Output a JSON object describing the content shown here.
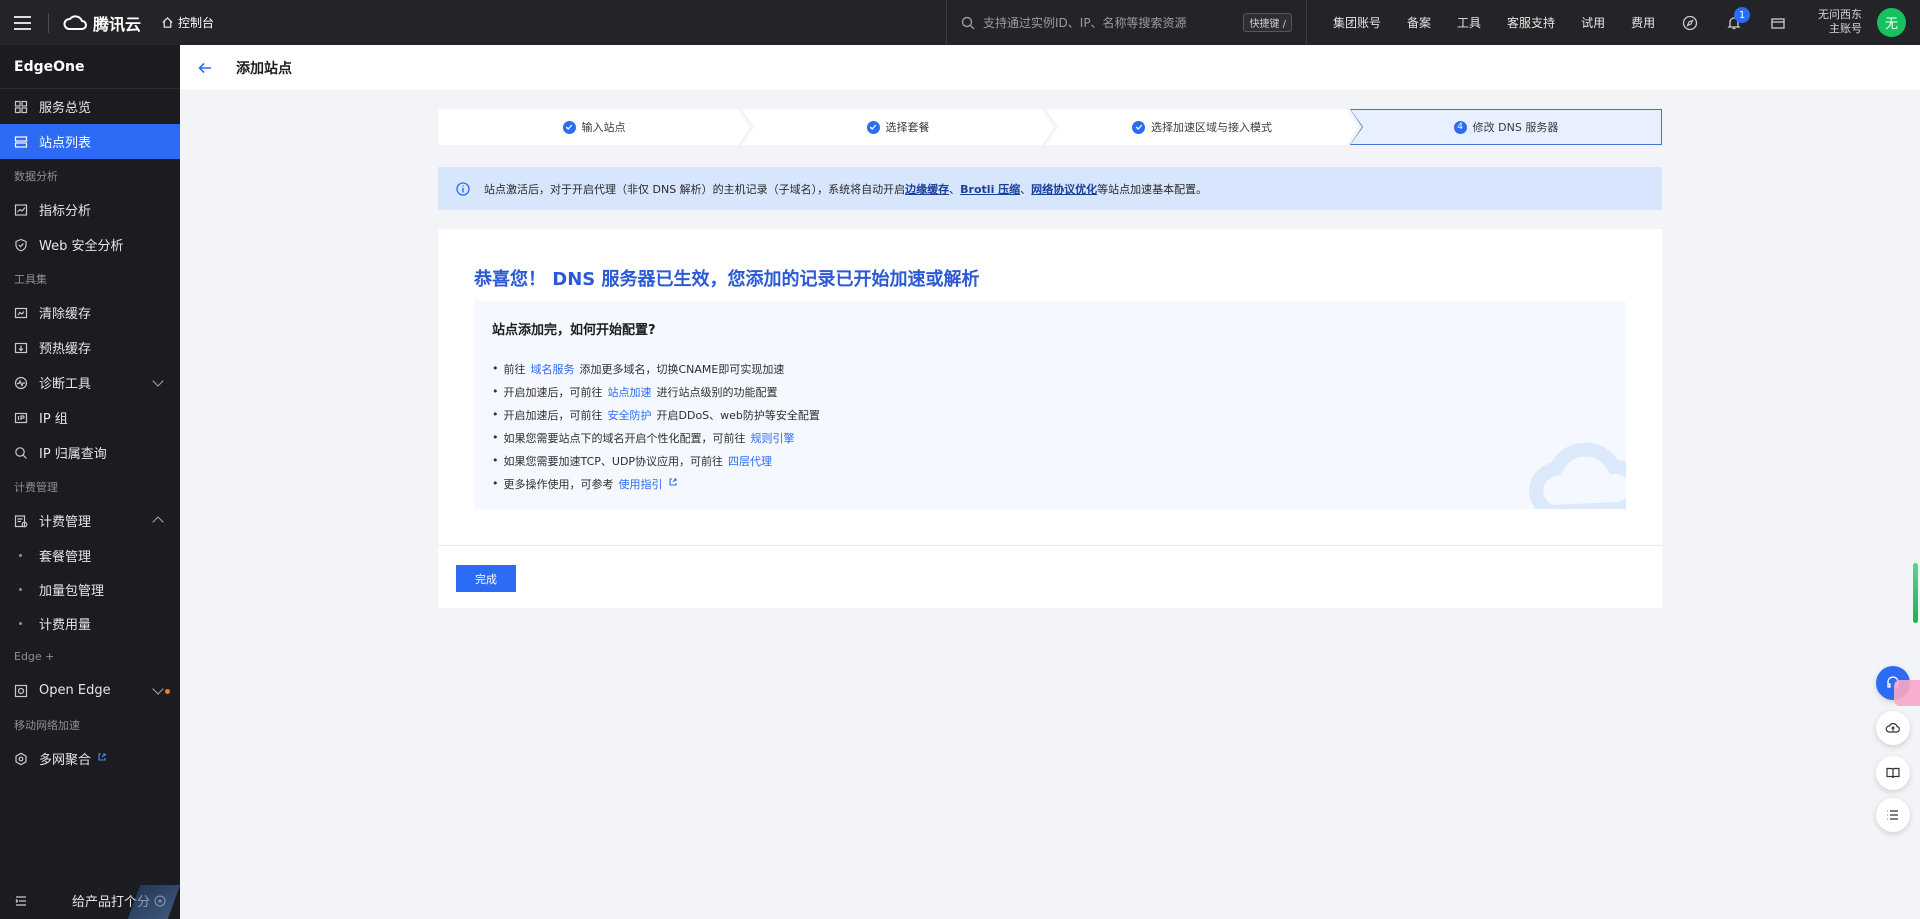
{
  "topbar": {
    "brand": "腾讯云",
    "console": "控制台",
    "search_placeholder": "支持通过实例ID、IP、名称等搜索资源",
    "shortcut": "快捷键 /",
    "links": [
      "集团账号",
      "备案",
      "工具",
      "客服支持",
      "试用",
      "费用"
    ],
    "notification_count": "1",
    "user_line1": "无问西东",
    "user_line2": "主账号",
    "avatar_text": "无"
  },
  "sidebar": {
    "product": "EdgeOne",
    "items": [
      {
        "type": "item",
        "label": "服务总览",
        "icon": "grid-icon"
      },
      {
        "type": "item",
        "label": "站点列表",
        "icon": "list-icon",
        "active": true
      },
      {
        "type": "group",
        "label": "数据分析"
      },
      {
        "type": "item",
        "label": "指标分析",
        "icon": "chart-icon"
      },
      {
        "type": "item",
        "label": "Web 安全分析",
        "icon": "shield-icon"
      },
      {
        "type": "group",
        "label": "工具集"
      },
      {
        "type": "item",
        "label": "清除缓存",
        "icon": "clear-cache-icon"
      },
      {
        "type": "item",
        "label": "预热缓存",
        "icon": "prefetch-icon"
      },
      {
        "type": "item",
        "label": "诊断工具",
        "icon": "diagnose-icon",
        "chevron": "down"
      },
      {
        "type": "item",
        "label": "IP 组",
        "icon": "ip-icon"
      },
      {
        "type": "item",
        "label": "IP 归属查询",
        "icon": "search-icon"
      },
      {
        "type": "group",
        "label": "计费管理"
      },
      {
        "type": "item",
        "label": "计费管理",
        "icon": "billing-icon",
        "chevron": "up"
      },
      {
        "type": "sub",
        "label": "套餐管理"
      },
      {
        "type": "sub",
        "label": "加量包管理"
      },
      {
        "type": "sub",
        "label": "计费用量"
      },
      {
        "type": "group",
        "label": "Edge +"
      },
      {
        "type": "item",
        "label": "Open Edge",
        "icon": "open-edge-icon",
        "chevron": "down",
        "dot": true
      },
      {
        "type": "group",
        "label": "移动网络加速"
      },
      {
        "type": "item",
        "label": "多网聚合",
        "icon": "multi-net-icon",
        "external": true
      }
    ],
    "footer_rate": "给产品打个分"
  },
  "page": {
    "title": "添加站点"
  },
  "steps": [
    {
      "label": "输入站点",
      "status": "done"
    },
    {
      "label": "选择套餐",
      "status": "done"
    },
    {
      "label": "选择加速区域与接入模式",
      "status": "done"
    },
    {
      "label": "修改 DNS 服务器",
      "status": "current",
      "number": "4"
    }
  ],
  "banner": {
    "prefix": "站点激活后，对于开启代理（非仅 DNS 解析）的主机记录（子域名），系统将自动开启 ",
    "link1": "边缘缓存",
    "sep1": "、",
    "link2": "Brotli 压缩",
    "sep2": "、",
    "link3": "网络协议优化",
    "suffix": " 等站点加速基本配置。"
  },
  "card": {
    "congrats": "恭喜您！ DNS 服务器已生效，您添加的记录已开始加速或解析",
    "guide_title": "站点添加完，如何开始配置?",
    "guide_items": [
      {
        "before": "前往",
        "link": "域名服务",
        "after": "添加更多域名，切换CNAME即可实现加速"
      },
      {
        "before": "开启加速后，可前往",
        "link": "站点加速",
        "after": "进行站点级别的功能配置"
      },
      {
        "before": "开启加速后，可前往",
        "link": "安全防护",
        "after": "开启DDoS、web防护等安全配置"
      },
      {
        "before": "如果您需要站点下的域名开启个性化配置，可前往",
        "link": "规则引擎",
        "after": ""
      },
      {
        "before": "如果您需要加速TCP、UDP协议应用，可前往",
        "link": "四层代理",
        "after": ""
      },
      {
        "before": "更多操作使用，可参考",
        "link": "使用指引",
        "after": ""
      }
    ],
    "done_button": "完成"
  },
  "colors": {
    "accent": "#2c6cf5",
    "topbar": "#232427",
    "sidebar": "#1b1c1f",
    "banner": "#d7e5fd"
  }
}
